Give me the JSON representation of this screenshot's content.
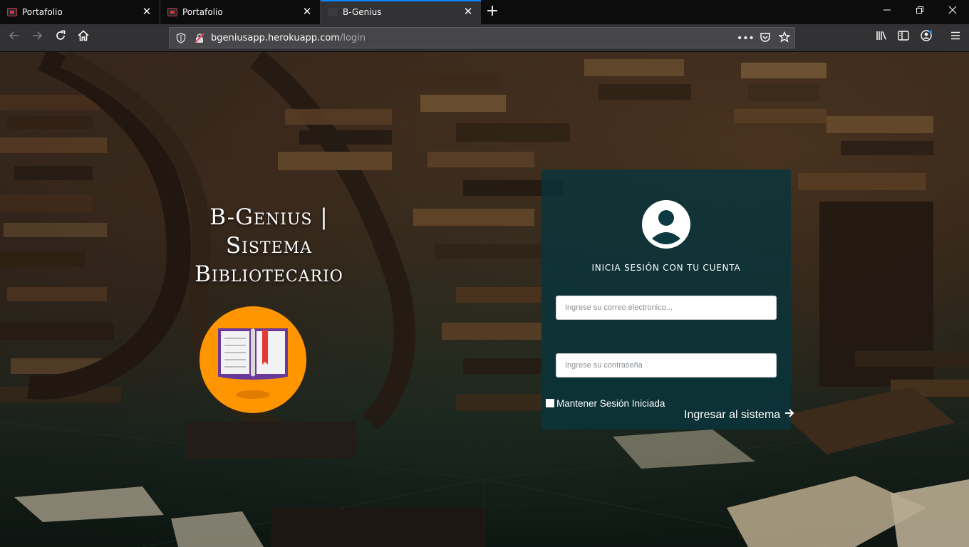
{
  "browser": {
    "tabs": [
      {
        "title": "Portafolio",
        "favicon": "portfolio-favicon"
      },
      {
        "title": "Portafolio",
        "favicon": "portfolio-favicon"
      },
      {
        "title": "B-Genius",
        "favicon": "default-favicon",
        "active": true
      }
    ],
    "url": {
      "host": "bgeniusapp.herokuapp.com",
      "path": "/login"
    },
    "accent_color": "#0a84ff"
  },
  "page": {
    "brand_line1": "B-Genius |",
    "brand_line2": "Sistema",
    "brand_line3": "Bibliotecario",
    "logo_color": "#ff9500",
    "login": {
      "title": "INICIA SESIÓN CON TU CUENTA",
      "email_placeholder": "Ingrese su correo electronico...",
      "password_placeholder": "Ingrese su contraseña",
      "remember_label": "Mantener Sesión Iniciada",
      "submit_label": "Ingresar al sistema",
      "panel_color": "#08343c"
    }
  }
}
